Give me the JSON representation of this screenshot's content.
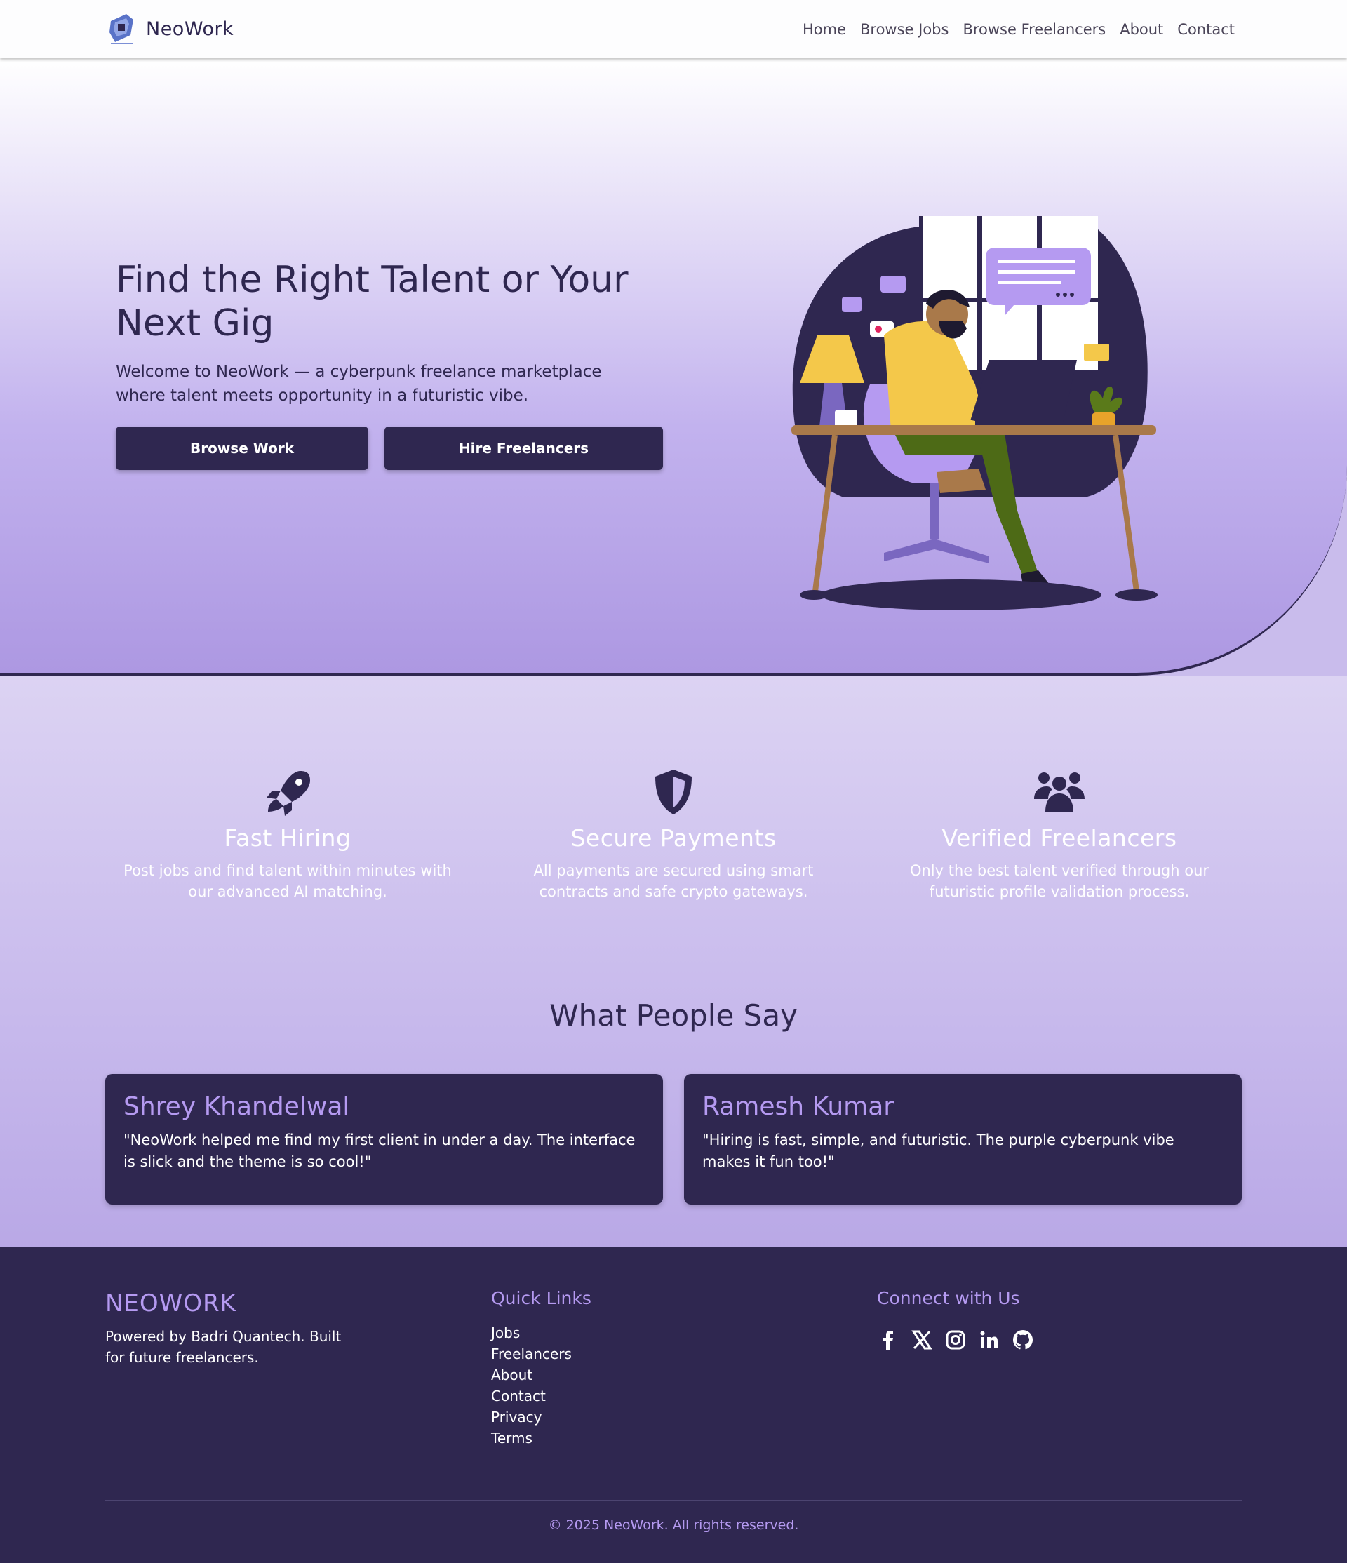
{
  "navbar": {
    "brand": "NeoWork",
    "links": [
      "Home",
      "Browse Jobs",
      "Browse Freelancers",
      "About",
      "Contact"
    ]
  },
  "hero": {
    "title": "Find the Right Talent or Your Next Gig",
    "subtitle": "Welcome to NeoWork — a cyberpunk freelance marketplace where talent meets opportunity in a futuristic vibe.",
    "buttons": {
      "browse": "Browse Work",
      "hire": "Hire Freelancers"
    },
    "illustration_icon": "freelancer-at-desk-illustration"
  },
  "features": [
    {
      "icon": "rocket-icon",
      "title": "Fast Hiring",
      "text": "Post jobs and find talent within minutes with our advanced AI matching."
    },
    {
      "icon": "shield-icon",
      "title": "Secure Payments",
      "text": "All payments are secured using smart contracts and safe crypto gateways."
    },
    {
      "icon": "users-icon",
      "title": "Verified Freelancers",
      "text": "Only the best talent verified through our futuristic profile validation process."
    }
  ],
  "testimonials": {
    "title": "What People Say",
    "items": [
      {
        "name": "Shrey Khandelwal",
        "quote": "\"NeoWork helped me find my first client in under a day. The interface is slick and the theme is so cool!\""
      },
      {
        "name": "Ramesh Kumar",
        "quote": "\"Hiring is fast, simple, and futuristic. The purple cyberpunk vibe makes it fun too!\""
      }
    ]
  },
  "footer": {
    "brand": "NEOWORK",
    "tagline": "Powered by Badri Quantech. Built for future freelancers.",
    "quick_links_title": "Quick Links",
    "quick_links": [
      "Jobs",
      "Freelancers",
      "About",
      "Contact",
      "Privacy",
      "Terms"
    ],
    "connect_title": "Connect with Us",
    "social_icons": [
      "facebook-icon",
      "x-icon",
      "instagram-icon",
      "linkedin-icon",
      "github-icon"
    ],
    "copyright": "© 2025 NeoWork. All rights reserved."
  },
  "colors": {
    "primary": "#2f2750",
    "accent": "#b59af1",
    "hero_gradient_end": "#ad98e2"
  }
}
